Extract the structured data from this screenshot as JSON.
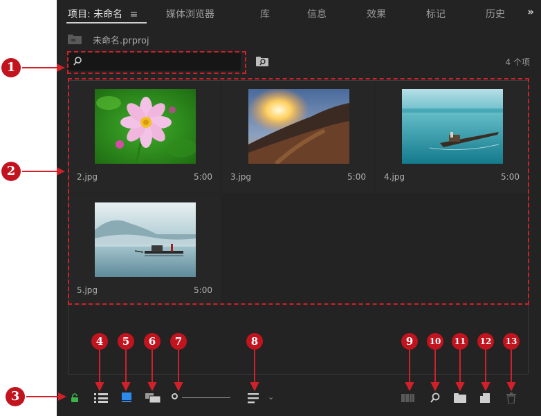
{
  "tabs": [
    {
      "label": "项目: 未命名",
      "menu_icon": "hamburger-icon"
    },
    {
      "label": "媒体浏览器"
    },
    {
      "label": "库"
    },
    {
      "label": "信息"
    },
    {
      "label": "效果"
    },
    {
      "label": "标记"
    },
    {
      "label": "历史"
    }
  ],
  "tabs_overflow": "»",
  "project": {
    "file_name": "未命名.prproj",
    "icon": "bin-folder-icon"
  },
  "search": {
    "placeholder": "",
    "value": "",
    "icon": "search-icon"
  },
  "find_button_icon": "find-in-bin-icon",
  "item_count": "4 个项",
  "items": [
    {
      "name": "2.jpg",
      "duration": "5:00",
      "subject": "pink-cosmos-flower"
    },
    {
      "name": "3.jpg",
      "duration": "5:00",
      "subject": "sunset-great-wall"
    },
    {
      "name": "4.jpg",
      "duration": "5:00",
      "subject": "boat-on-teal-river"
    },
    {
      "name": "5.jpg",
      "duration": "5:00",
      "subject": "misty-lake-boat"
    }
  ],
  "toolbar": {
    "lock_icon": "lock-icon",
    "list_view_icon": "list-view-icon",
    "icon_view_icon": "icon-view-icon",
    "freeform_view_icon": "freeform-view-icon",
    "zoom_slider_icon": "zoom-slider",
    "sort_icon": "sort-icons-icon",
    "automate_icon": "automate-to-sequence-icon",
    "find_icon": "find-icon",
    "new_bin_icon": "new-bin-icon",
    "new_item_icon": "new-item-icon",
    "clear_icon": "trash-icon"
  },
  "callouts": [
    "1",
    "2",
    "3",
    "4",
    "5",
    "6",
    "7",
    "8",
    "9",
    "10",
    "11",
    "12",
    "13"
  ],
  "colors": {
    "panel_bg": "#232323",
    "accent_blue": "#2d8ceb",
    "lock_green": "#3bb54a",
    "callout_red": "#c2141f"
  }
}
